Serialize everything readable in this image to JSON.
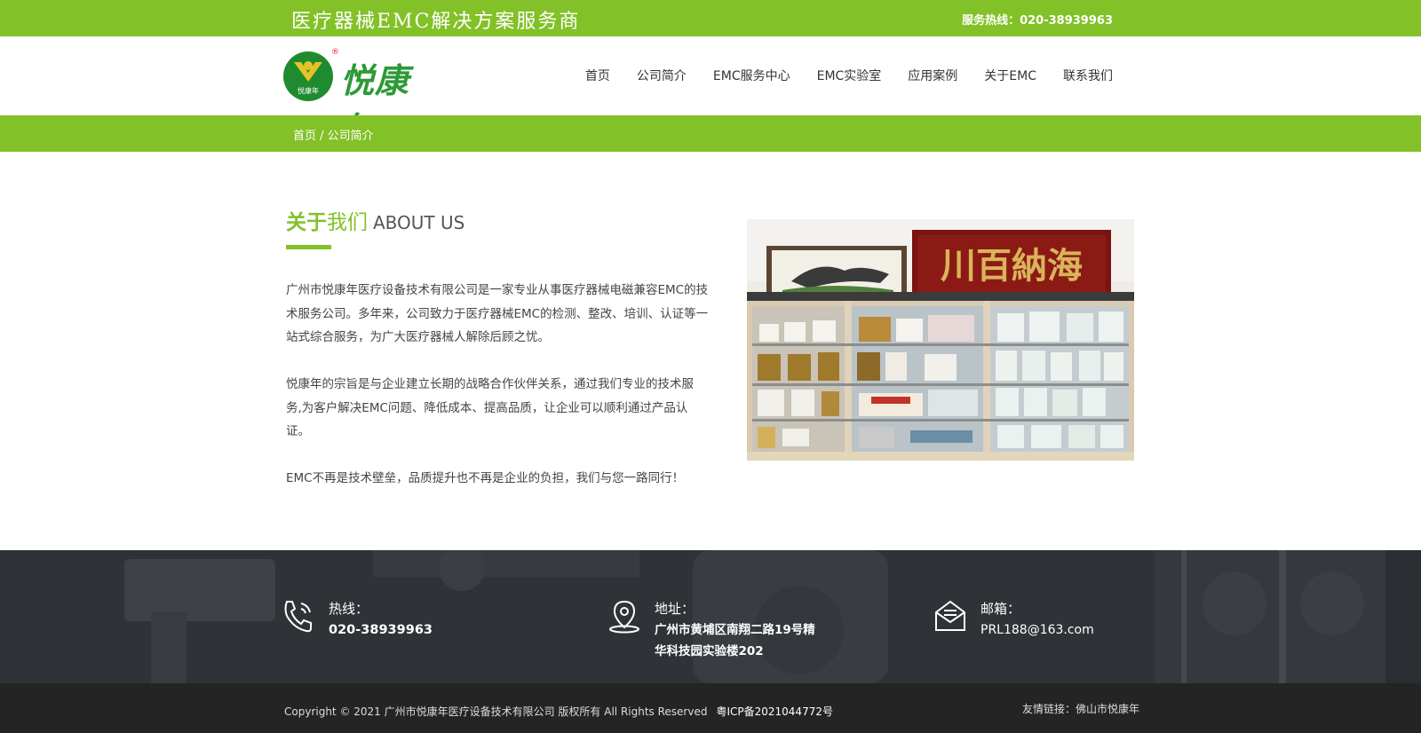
{
  "topbar": {
    "slogan": "医疗器械EMC解决方案服务商",
    "hotline": "服务热线：020-38939963"
  },
  "logo": {
    "brand": "悦康年",
    "emblem_text": "悦康年",
    "reg": "®"
  },
  "nav": {
    "items": [
      "首页",
      "公司简介",
      "EMC服务中心",
      "EMC实验室",
      "应用案例",
      "关于EMC",
      "联系我们"
    ]
  },
  "breadcrumb": {
    "home": "首页",
    "separator": " / ",
    "current": "公司简介"
  },
  "about": {
    "title_a": "关于",
    "title_b": "我们",
    "title_en": "ABOUT US",
    "paragraphs": [
      "广州市悦康年医疗设备技术有限公司是一家专业从事医疗器械电磁兼容EMC的技术服务公司。多年来，公司致力于医疗器械EMC的检测、整改、培训、认证等一站式综合服务，为广大医疗器械人解除后顾之忧。",
      "悦康年的宗旨是与企业建立长期的战略合作伙伴关系，通过我们专业的技术服务,为客户解决EMC问题、降低成本、提高品质，让企业可以顺利通过产品认证。",
      "EMC不再是技术壁垒，品质提升也不再是企业的负担，我们与您一路同行！"
    ],
    "photo_plaque": "川百納海"
  },
  "contact": {
    "hotline_label": "热线：",
    "hotline_value": "020-38939963",
    "address_label": "地址：",
    "address_line1": "广州市黄埔区南翔二路19号精",
    "address_line2": "华科技园实验楼202",
    "email_label": "邮箱：",
    "email_value": "PRL188@163.com"
  },
  "footer": {
    "copyright": "Copyright © 2021 广州市悦康年医疗设备技术有限公司 版权所有 All Rights Reserved",
    "icp": "粤ICP备2021044772号",
    "friend_links": "友情链接：佛山市悦康年"
  },
  "colors": {
    "brand_green": "#82c127",
    "logo_green": "#2d9a38",
    "footer_dark": "#2f3236",
    "bottom_dark": "#242424"
  }
}
